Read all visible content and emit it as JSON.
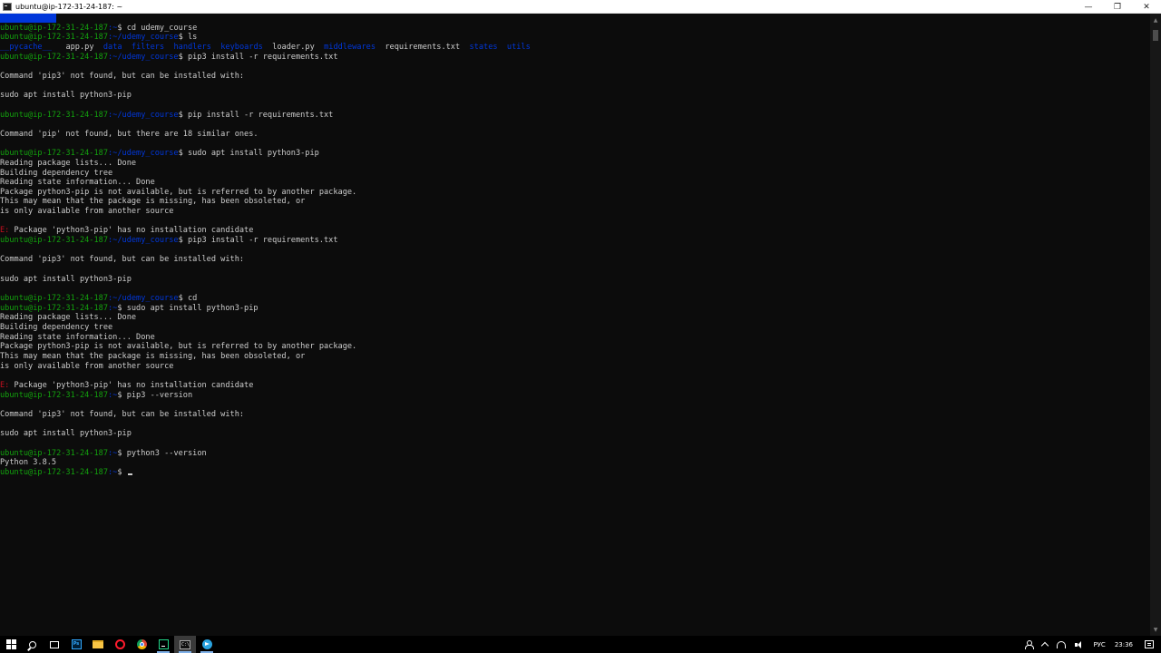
{
  "window": {
    "title": "ubuntu@ip-172-31-24-187: ~",
    "minimize_glyph": "—",
    "restore_glyph": "❐",
    "close_glyph": "✕"
  },
  "colors": {
    "background": "#0c0c0c",
    "text": "#cccccc",
    "prompt_user": "#13a10e",
    "prompt_path": "#0037da",
    "error": "#c50f1f"
  },
  "console": {
    "lines": [
      [
        {
          "t": "udemy_course",
          "c": "bg-blue"
        }
      ],
      [
        {
          "t": "ubuntu@ip-172-31-24-187",
          "c": "green"
        },
        {
          "t": ":~",
          "c": "blue"
        },
        {
          "t": "$ cd udemy_course",
          "c": "default"
        }
      ],
      [
        {
          "t": "ubuntu@ip-172-31-24-187",
          "c": "green"
        },
        {
          "t": ":~/udemy_course",
          "c": "blue"
        },
        {
          "t": "$ ls",
          "c": "default"
        }
      ],
      [
        {
          "t": "__pycache__",
          "c": "blue"
        },
        {
          "t": "   app.py  ",
          "c": "default"
        },
        {
          "t": "data",
          "c": "blue"
        },
        {
          "t": "  ",
          "c": "default"
        },
        {
          "t": "filters",
          "c": "blue"
        },
        {
          "t": "  ",
          "c": "default"
        },
        {
          "t": "handlers",
          "c": "blue"
        },
        {
          "t": "  ",
          "c": "default"
        },
        {
          "t": "keyboards",
          "c": "blue"
        },
        {
          "t": "  loader.py  ",
          "c": "default"
        },
        {
          "t": "middlewares",
          "c": "blue"
        },
        {
          "t": "  requirements.txt  ",
          "c": "default"
        },
        {
          "t": "states",
          "c": "blue"
        },
        {
          "t": "  ",
          "c": "default"
        },
        {
          "t": "utils",
          "c": "blue"
        }
      ],
      [
        {
          "t": "ubuntu@ip-172-31-24-187",
          "c": "green"
        },
        {
          "t": ":~/udemy_course",
          "c": "blue"
        },
        {
          "t": "$ pip3 install -r requirements.txt",
          "c": "default"
        }
      ],
      [],
      [
        {
          "t": "Command 'pip3' not found, but can be installed with:",
          "c": "default"
        }
      ],
      [],
      [
        {
          "t": "sudo apt install python3-pip",
          "c": "default"
        }
      ],
      [],
      [
        {
          "t": "ubuntu@ip-172-31-24-187",
          "c": "green"
        },
        {
          "t": ":~/udemy_course",
          "c": "blue"
        },
        {
          "t": "$ pip install -r requirements.txt",
          "c": "default"
        }
      ],
      [],
      [
        {
          "t": "Command 'pip' not found, but there are 18 similar ones.",
          "c": "default"
        }
      ],
      [],
      [
        {
          "t": "ubuntu@ip-172-31-24-187",
          "c": "green"
        },
        {
          "t": ":~/udemy_course",
          "c": "blue"
        },
        {
          "t": "$ sudo apt install python3-pip",
          "c": "default"
        }
      ],
      [
        {
          "t": "Reading package lists... Done",
          "c": "default"
        }
      ],
      [
        {
          "t": "Building dependency tree",
          "c": "default"
        }
      ],
      [
        {
          "t": "Reading state information... Done",
          "c": "default"
        }
      ],
      [
        {
          "t": "Package python3-pip is not available, but is referred to by another package.",
          "c": "default"
        }
      ],
      [
        {
          "t": "This may mean that the package is missing, has been obsoleted, or",
          "c": "default"
        }
      ],
      [
        {
          "t": "is only available from another source",
          "c": "default"
        }
      ],
      [],
      [
        {
          "t": "E:",
          "c": "red"
        },
        {
          "t": " Package 'python3-pip' has no installation candidate",
          "c": "default"
        }
      ],
      [
        {
          "t": "ubuntu@ip-172-31-24-187",
          "c": "green"
        },
        {
          "t": ":~/udemy_course",
          "c": "blue"
        },
        {
          "t": "$ pip3 install -r requirements.txt",
          "c": "default"
        }
      ],
      [],
      [
        {
          "t": "Command 'pip3' not found, but can be installed with:",
          "c": "default"
        }
      ],
      [],
      [
        {
          "t": "sudo apt install python3-pip",
          "c": "default"
        }
      ],
      [],
      [
        {
          "t": "ubuntu@ip-172-31-24-187",
          "c": "green"
        },
        {
          "t": ":~/udemy_course",
          "c": "blue"
        },
        {
          "t": "$ cd",
          "c": "default"
        }
      ],
      [
        {
          "t": "ubuntu@ip-172-31-24-187",
          "c": "green"
        },
        {
          "t": ":~",
          "c": "blue"
        },
        {
          "t": "$ sudo apt install python3-pip",
          "c": "default"
        }
      ],
      [
        {
          "t": "Reading package lists... Done",
          "c": "default"
        }
      ],
      [
        {
          "t": "Building dependency tree",
          "c": "default"
        }
      ],
      [
        {
          "t": "Reading state information... Done",
          "c": "default"
        }
      ],
      [
        {
          "t": "Package python3-pip is not available, but is referred to by another package.",
          "c": "default"
        }
      ],
      [
        {
          "t": "This may mean that the package is missing, has been obsoleted, or",
          "c": "default"
        }
      ],
      [
        {
          "t": "is only available from another source",
          "c": "default"
        }
      ],
      [],
      [
        {
          "t": "E:",
          "c": "red"
        },
        {
          "t": " Package 'python3-pip' has no installation candidate",
          "c": "default"
        }
      ],
      [
        {
          "t": "ubuntu@ip-172-31-24-187",
          "c": "green"
        },
        {
          "t": ":~",
          "c": "blue"
        },
        {
          "t": "$ pip3 --version",
          "c": "default"
        }
      ],
      [],
      [
        {
          "t": "Command 'pip3' not found, but can be installed with:",
          "c": "default"
        }
      ],
      [],
      [
        {
          "t": "sudo apt install python3-pip",
          "c": "default"
        }
      ],
      [],
      [
        {
          "t": "ubuntu@ip-172-31-24-187",
          "c": "green"
        },
        {
          "t": ":~",
          "c": "blue"
        },
        {
          "t": "$ python3 --version",
          "c": "default"
        }
      ],
      [
        {
          "t": "Python 3.8.5",
          "c": "default"
        }
      ],
      [
        {
          "t": "ubuntu@ip-172-31-24-187",
          "c": "green"
        },
        {
          "t": ":~",
          "c": "blue"
        },
        {
          "t": "$ ",
          "c": "default"
        }
      ]
    ]
  },
  "taskbar": {
    "apps": [
      {
        "name": "start-button",
        "icon": "windows-logo-icon"
      },
      {
        "name": "search-button",
        "icon": "search-icon"
      },
      {
        "name": "task-view-button",
        "icon": "task-view-icon"
      },
      {
        "name": "photoshop-button",
        "icon": "photoshop-icon",
        "label": "Ps"
      },
      {
        "name": "file-explorer-button",
        "icon": "folder-icon"
      },
      {
        "name": "opera-button",
        "icon": "opera-icon"
      },
      {
        "name": "chrome-button",
        "icon": "chrome-icon"
      },
      {
        "name": "pycharm-button",
        "icon": "pycharm-icon"
      },
      {
        "name": "terminal-button",
        "icon": "terminal-icon",
        "label": "C:\\",
        "active": true
      },
      {
        "name": "telegram-button",
        "icon": "telegram-icon"
      }
    ],
    "tray": {
      "language": "РУС",
      "time": "23:36"
    }
  }
}
